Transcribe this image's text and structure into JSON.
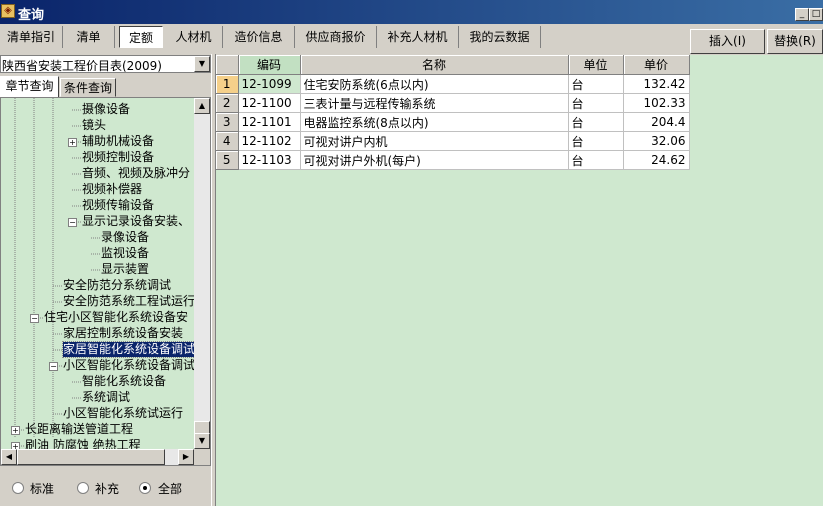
{
  "window": {
    "title": "查询",
    "min_label": "_",
    "max_label": "□"
  },
  "tabs": [
    {
      "label": "清单指引",
      "active": false
    },
    {
      "label": "清单",
      "active": false
    },
    {
      "label": "定额",
      "active": true
    },
    {
      "label": "人材机",
      "active": false
    },
    {
      "label": "造价信息",
      "active": false
    },
    {
      "label": "供应商报价",
      "active": false
    },
    {
      "label": "补充人材机",
      "active": false
    },
    {
      "label": "我的云数据",
      "active": false
    }
  ],
  "actions": {
    "insert_label": "插入(I)",
    "replace_label": "替换(R)"
  },
  "left": {
    "catalog_value": "陕西省安装工程价目表(2009)",
    "subtabs": [
      {
        "label": "章节查询",
        "active": true
      },
      {
        "label": "条件查询",
        "active": false
      }
    ],
    "tree": [
      {
        "label": "摄像设备",
        "depth": 4,
        "toggle": null,
        "selected": false
      },
      {
        "label": "镜头",
        "depth": 4,
        "toggle": null,
        "selected": false
      },
      {
        "label": "辅助机械设备",
        "depth": 4,
        "toggle": "+",
        "selected": false
      },
      {
        "label": "视频控制设备",
        "depth": 4,
        "toggle": null,
        "selected": false
      },
      {
        "label": "音频、视频及脉冲分",
        "depth": 4,
        "toggle": null,
        "selected": false
      },
      {
        "label": "视频补偿器",
        "depth": 4,
        "toggle": null,
        "selected": false
      },
      {
        "label": "视频传输设备",
        "depth": 4,
        "toggle": null,
        "selected": false
      },
      {
        "label": "显示记录设备安装、",
        "depth": 4,
        "toggle": "−",
        "selected": false
      },
      {
        "label": "录像设备",
        "depth": 5,
        "toggle": null,
        "selected": false
      },
      {
        "label": "监视设备",
        "depth": 5,
        "toggle": null,
        "selected": false
      },
      {
        "label": "显示装置",
        "depth": 5,
        "toggle": null,
        "selected": false
      },
      {
        "label": "安全防范分系统调试",
        "depth": 3,
        "toggle": null,
        "selected": false
      },
      {
        "label": "安全防范系统工程试运行",
        "depth": 3,
        "toggle": null,
        "selected": false
      },
      {
        "label": "住宅小区智能化系统设备安",
        "depth": 2,
        "toggle": "−",
        "selected": false
      },
      {
        "label": "家居控制系统设备安装",
        "depth": 3,
        "toggle": null,
        "selected": false
      },
      {
        "label": "家居智能化系统设备调试",
        "depth": 3,
        "toggle": null,
        "selected": true
      },
      {
        "label": "小区智能化系统设备调试",
        "depth": 3,
        "toggle": "−",
        "selected": false
      },
      {
        "label": "智能化系统设备",
        "depth": 4,
        "toggle": null,
        "selected": false
      },
      {
        "label": "系统调试",
        "depth": 4,
        "toggle": null,
        "selected": false
      },
      {
        "label": "小区智能化系统试运行",
        "depth": 3,
        "toggle": null,
        "selected": false
      },
      {
        "label": "长距离输送管道工程",
        "depth": 1,
        "toggle": "+",
        "selected": false
      },
      {
        "label": "刷油 防腐蚀 绝热工程",
        "depth": 1,
        "toggle": "+",
        "selected": false
      }
    ],
    "filters": [
      {
        "label": "标准",
        "checked": false
      },
      {
        "label": "补充",
        "checked": false
      },
      {
        "label": "全部",
        "checked": true
      }
    ]
  },
  "grid": {
    "columns": [
      "编码",
      "名称",
      "单位",
      "单价"
    ],
    "rows": [
      {
        "num": "1",
        "code": "12-1099",
        "name": "住宅安防系统(6点以内)",
        "unit": "台",
        "price": "132.42"
      },
      {
        "num": "2",
        "code": "12-1100",
        "name": "三表计量与远程传输系统",
        "unit": "台",
        "price": "102.33"
      },
      {
        "num": "3",
        "code": "12-1101",
        "name": "电器监控系统(8点以内)",
        "unit": "台",
        "price": "204.4"
      },
      {
        "num": "4",
        "code": "12-1102",
        "name": "可视对讲户内机",
        "unit": "台",
        "price": "32.06"
      },
      {
        "num": "5",
        "code": "12-1103",
        "name": "可视对讲户外机(每户)",
        "unit": "台",
        "price": "24.62"
      }
    ]
  }
}
